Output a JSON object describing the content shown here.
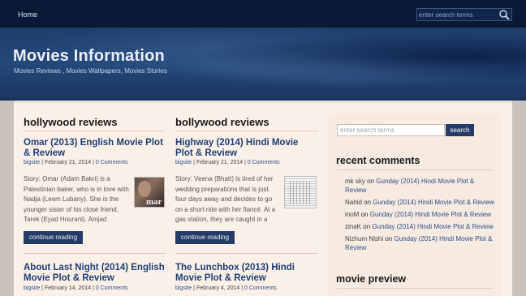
{
  "nav": {
    "home": "Home"
  },
  "top_search": {
    "placeholder": "enter search terms"
  },
  "site": {
    "title": "Movies Information",
    "tagline": "Movies Reviews , Movies Wallpapers, Movies Stories"
  },
  "columns": [
    {
      "heading": "hollywood reviews",
      "posts": [
        {
          "title": "Omar (2013) English Movie Plot & Review",
          "author": "bigsite",
          "date": "February 21, 2014",
          "comments": "0 Comments",
          "excerpt": "Story: Omar (Adam Bakri) is a Palestinian baker, who is in love with Nadja (Leem Lubany). She is the younger sister of his close friend, Tarek (Eyad Hourani). Amjad",
          "button": "continue reading",
          "thumb_text": "mar"
        },
        {
          "title": "About Last Night (2014) English Movie Plot & Review",
          "author": "bigsite",
          "date": "February 14, 2014",
          "comments": "0 Comments"
        }
      ]
    },
    {
      "heading": "bollywood reviews",
      "posts": [
        {
          "title": "Highway (2014) Hindi Movie Plot & Review",
          "author": "bigsite",
          "date": "February 21, 2014",
          "comments": "0 Comments",
          "excerpt": "Story: Veena (Bhatt) is tired of her wedding preparations that is just four days away and decides to go on a short ride with her fiancé. At a gas station, they are caught in a",
          "button": "continue reading"
        },
        {
          "title": "The Lunchbox (2013) Hindi Movie Plot & Review",
          "author": "bigsite",
          "date": "February 4, 2014",
          "comments": "0 Comments"
        }
      ]
    }
  ],
  "sidebar": {
    "search_placeholder": "enter search terms",
    "search_button": "search",
    "recent_heading": "recent comments",
    "comments": [
      {
        "author": "mk sky",
        "on": "on",
        "post": "Gunday (2014) Hindi Movie Plot & Review"
      },
      {
        "author": "Nahid",
        "on": "on",
        "post": "Gunday (2014) Hindi Movie Plot & Review"
      },
      {
        "author": "inoM",
        "on": "on",
        "post": "Gunday (2014) Hindi Movie Plot & Review"
      },
      {
        "author": "zinaK",
        "on": "on",
        "post": "Gunday (2014) Hindi Movie Plot & Review"
      },
      {
        "author": "Nizhum Nishi",
        "on": "on",
        "post": "Gunday (2014) Hindi Movie Plot & Review"
      }
    ],
    "preview_heading": "movie preview"
  },
  "colors": {
    "topbar": "#081a36",
    "header": "#24487a",
    "link": "#2d4f8a",
    "title": "#1f3f74",
    "button": "#243b66",
    "content_bg": "#faf0e8"
  }
}
